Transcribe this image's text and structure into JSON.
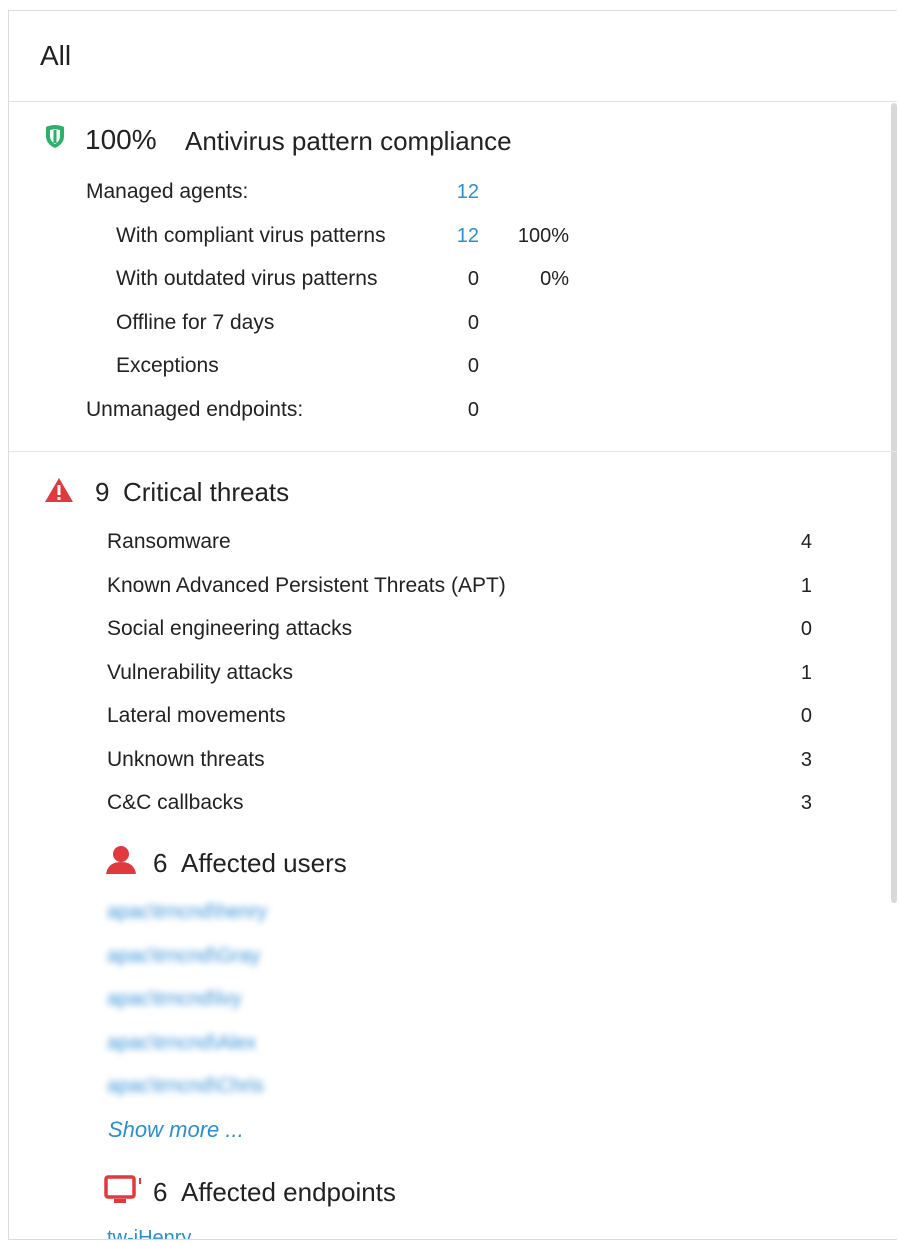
{
  "panel": {
    "title": "All"
  },
  "compliance": {
    "percent": "100%",
    "title": "Antivirus pattern compliance",
    "managed_label": "Managed agents:",
    "managed_count": "12",
    "rows": [
      {
        "label": "With compliant virus patterns",
        "count": "12",
        "pct": "100%"
      },
      {
        "label": "With outdated virus patterns",
        "count": "0",
        "pct": "0%"
      },
      {
        "label": "Offline for 7 days",
        "count": "0",
        "pct": ""
      },
      {
        "label": "Exceptions",
        "count": "0",
        "pct": ""
      }
    ],
    "unmanaged_label": "Unmanaged endpoints:",
    "unmanaged_count": "0"
  },
  "threats": {
    "count": "9",
    "title": "Critical threats",
    "rows": [
      {
        "label": "Ransomware",
        "count": "4"
      },
      {
        "label": "Known Advanced Persistent Threats (APT)",
        "count": "1"
      },
      {
        "label": "Social engineering attacks",
        "count": "0"
      },
      {
        "label": "Vulnerability attacks",
        "count": "1"
      },
      {
        "label": "Lateral movements",
        "count": "0"
      },
      {
        "label": "Unknown threats",
        "count": "3"
      },
      {
        "label": "C&C callbacks",
        "count": "3"
      }
    ]
  },
  "affected_users": {
    "count": "6",
    "title": "Affected users",
    "users": [
      "apac\\trncnd\\henry",
      "apac\\trncnd\\Gray",
      "apac\\trncnd\\lvy",
      "apac\\trncnd\\Alex",
      "apac\\trncnd\\Chris"
    ],
    "show_more": "Show more ..."
  },
  "affected_endpoints": {
    "count": "6",
    "title": "Affected endpoints",
    "first": "tw-iHenry"
  },
  "colors": {
    "shield": "#2db16a",
    "alert": "#e0393e",
    "link": "#2a8fd0"
  },
  "icons": [
    "shield-icon",
    "warning-triangle-icon",
    "user-icon",
    "monitor-icon"
  ]
}
